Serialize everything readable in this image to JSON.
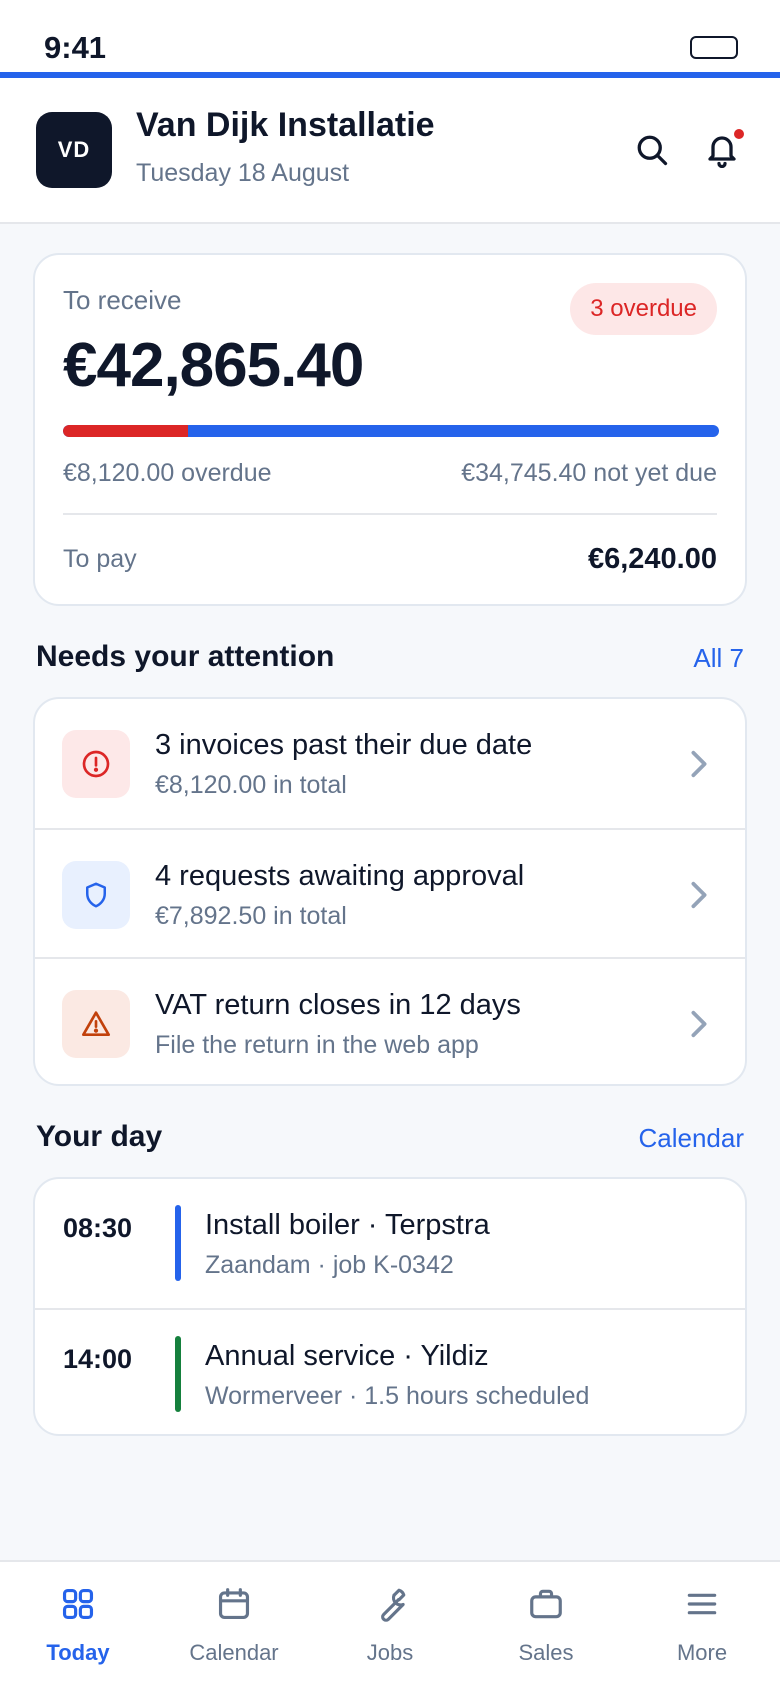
{
  "status_bar": {
    "time": "9:41"
  },
  "header": {
    "avatar_initials": "VD",
    "company": "Van Dijk Installatie",
    "date": "Tuesday 18 August"
  },
  "summary": {
    "to_receive_label": "To receive",
    "overdue_badge": "3 overdue",
    "receive_amount": "€42,865.40",
    "overdue_fraction": 0.19,
    "overdue_amount": "€8,120.00 overdue",
    "not_due_amount": "€34,745.40 not yet due",
    "to_pay_label": "To pay",
    "to_pay_amount": "€6,240.00"
  },
  "attention": {
    "title": "Needs your attention",
    "link": "All 7",
    "items": [
      {
        "title": "3 invoices past their due date",
        "sub": "€8,120.00 in total",
        "icon": "alert-circle-icon"
      },
      {
        "title": "4 requests awaiting approval",
        "sub": "€7,892.50 in total",
        "icon": "shield-icon"
      },
      {
        "title": "VAT return closes in 12 days",
        "sub": "File the return in the web app",
        "icon": "warning-triangle-icon"
      }
    ]
  },
  "day": {
    "title": "Your day",
    "link": "Calendar",
    "items": [
      {
        "time": "08:30",
        "title": "Install boiler · Terpstra",
        "sub": "Zaandam · job K-0342",
        "color": "#2563eb"
      },
      {
        "time": "14:00",
        "title": "Annual service · Yildiz",
        "sub": "Wormerveer · 1.5 hours scheduled",
        "color": "#15803d"
      }
    ]
  },
  "tabs": [
    {
      "label": "Today",
      "active": true
    },
    {
      "label": "Calendar",
      "active": false
    },
    {
      "label": "Jobs",
      "active": false
    },
    {
      "label": "Sales",
      "active": false
    },
    {
      "label": "More",
      "active": false
    }
  ],
  "colors": {
    "accent": "#2563eb",
    "danger": "#dc2626",
    "warning": "#c2410c",
    "success": "#15803d"
  }
}
